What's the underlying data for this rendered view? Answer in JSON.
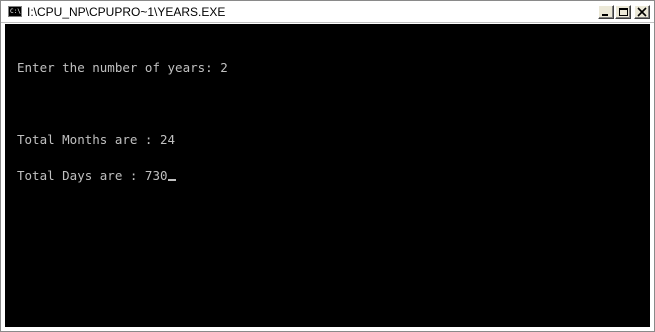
{
  "window": {
    "title": "I:\\CPU_NP\\CPUPRO~1\\YEARS.EXE",
    "icon": "console-icon",
    "icon_text": "C:\\"
  },
  "caption_buttons": {
    "minimize": "minimize-icon",
    "maximize": "maximize-icon",
    "close": "close-icon"
  },
  "console": {
    "background": "#000000",
    "foreground": "#c0c0c0",
    "lines": [
      "Enter the number of years: 2",
      "",
      "Total Months are : 24",
      "Total Days are : 730"
    ]
  }
}
